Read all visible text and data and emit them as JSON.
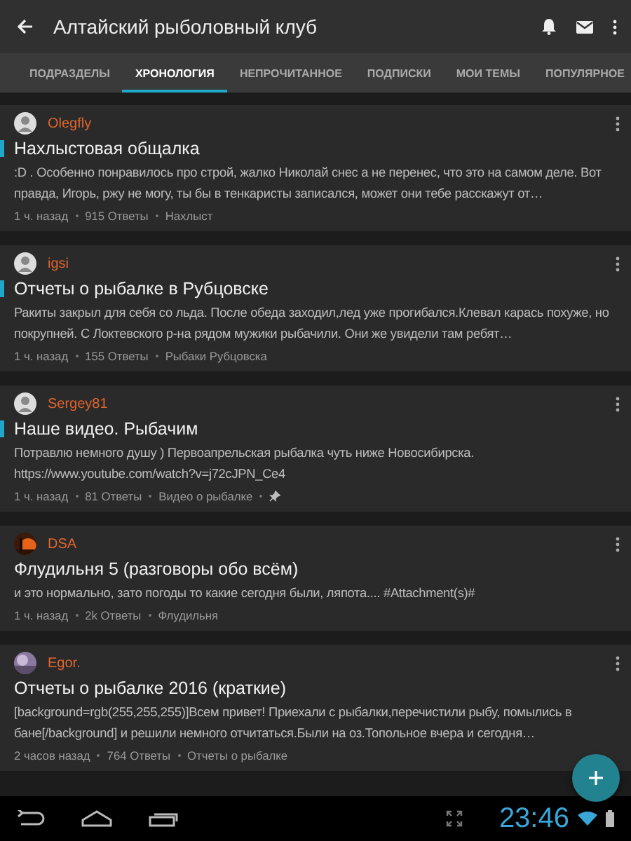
{
  "app_bar": {
    "title": "Алтайский рыболовный клуб"
  },
  "tabs": [
    {
      "label": "ПОДРАЗДЕЛЫ",
      "selected": false
    },
    {
      "label": "ХРОНОЛОГИЯ",
      "selected": true
    },
    {
      "label": "НЕПРОЧИТАННОЕ",
      "selected": false
    },
    {
      "label": "ПОДПИСКИ",
      "selected": false
    },
    {
      "label": "МОИ ТЕМЫ",
      "selected": false
    },
    {
      "label": "ПОПУЛЯРНОЕ",
      "selected": false
    }
  ],
  "topics": [
    {
      "author": "Olegfly",
      "avatar": {
        "kind": "default"
      },
      "unread": true,
      "pinned": false,
      "title": "Нахлыстовая общалка",
      "preview": ":D . Особенно понравилось про строй, жалко Николай снес а не перенес, что это на самом деле. Вот правда, Игорь, ржу не могу, ты бы в тенкаристы записался, может они тебе расскажут от…",
      "time": "1 ч. назад",
      "replies": "915 Ответы",
      "forum": "Нахлыст"
    },
    {
      "author": "igsi",
      "avatar": {
        "kind": "default"
      },
      "unread": true,
      "pinned": false,
      "title": "Отчеты о рыбалке в Рубцовске",
      "preview": "Ракиты закрыл для себя со льда. После обеда заходил,лед уже прогибался.Клевал карась похуже, но покрупней. С Локтевского р-на рядом мужики рыбачили. Они же увидели там ребят…",
      "time": "1 ч. назад",
      "replies": "155 Ответы",
      "forum": "Рыбаки Рубцовска"
    },
    {
      "author": "Sergey81",
      "avatar": {
        "kind": "default"
      },
      "unread": true,
      "pinned": true,
      "title": "Наше видео. Рыбачим",
      "preview": "Потравлю немного душу ) Первоапрельская рыбалка чуть ниже Новосибирска. https://www.youtube.com/watch?v=j72cJPN_Ce4",
      "time": "1 ч. назад",
      "replies": "81 Ответы",
      "forum": "Видео о рыбалке"
    },
    {
      "author": "DSA",
      "unread": false,
      "pinned": false,
      "title": "Флудильня 5 (разговоры обо всём)",
      "preview": "и это нормально, зато погоды то какие сегодня были, ляпота.... #Attachment(s)#",
      "time": "1 ч. назад",
      "replies": "2k Ответы",
      "forum": "Флудильня"
    },
    {
      "author": "Egor.",
      "unread": false,
      "pinned": false,
      "title": "Отчеты о рыбалке 2016 (краткие)",
      "preview": "[background=rgb(255,255,255)]Всем привет! Приехали с рыбалки,перечистили рыбу, помылись в бане[/background] и решили немного отчитаться.Были на оз.Топольное вчера и сегодня…",
      "time": "2 часов назад",
      "replies": "764 Ответы",
      "forum": "Отчеты о рыбалке"
    }
  ],
  "status_bar": {
    "time": "23:46"
  }
}
